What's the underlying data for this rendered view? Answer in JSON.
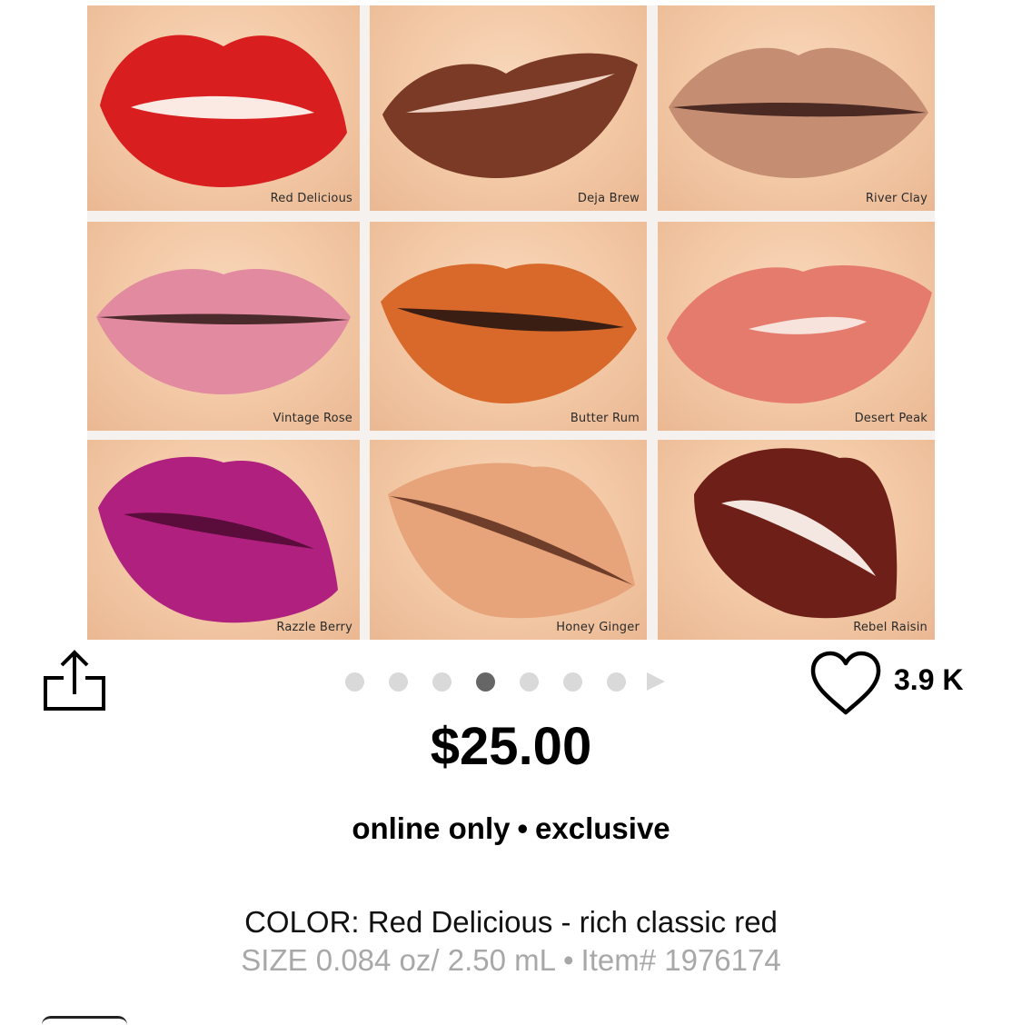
{
  "gallery": {
    "shades": [
      {
        "name": "Red Delicious",
        "color": "#d81e1e"
      },
      {
        "name": "Deja Brew",
        "color": "#7a3a26"
      },
      {
        "name": "River Clay",
        "color": "#c58e72"
      },
      {
        "name": "Vintage Rose",
        "color": "#e28aa0"
      },
      {
        "name": "Butter Rum",
        "color": "#d8692a"
      },
      {
        "name": "Desert Peak",
        "color": "#e57b6d"
      },
      {
        "name": "Razzle Berry",
        "color": "#b0207f"
      },
      {
        "name": "Honey Ginger",
        "color": "#e7a47b"
      },
      {
        "name": "Rebel Raisin",
        "color": "#6e1f18"
      }
    ]
  },
  "carousel": {
    "dot_count": 7,
    "active_index": 3
  },
  "actions": {
    "share_icon": "share-icon",
    "heart_icon": "heart-icon",
    "loves_count": "3.9 K"
  },
  "product": {
    "price": "$25.00",
    "badges": [
      "online only",
      "exclusive"
    ],
    "color_line": "COLOR: Red Delicious - rich classic red",
    "size_text": "SIZE 0.084 oz/ 2.50 mL",
    "item_text": "Item# 1976174"
  }
}
